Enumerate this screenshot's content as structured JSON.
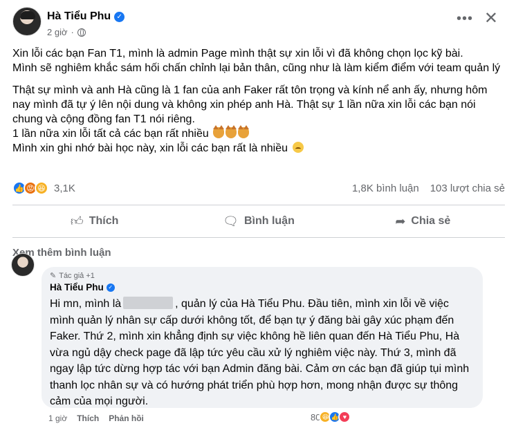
{
  "post": {
    "author": "Hà Tiểu Phu",
    "time": "2 giờ",
    "paragraphs": [
      "Xin lỗi các bạn Fan T1, mình là admin Page mình thật sự xin lỗi vì đã không chọn lọc kỹ bài.",
      "Mình sẽ nghiêm khắc sám hối chấn chỉnh lại bản thân, cũng như là làm kiểm điểm với team quản lý",
      "Thật sự mình và anh Hà cũng là 1 fan của anh Faker rất tôn trọng và kính nể anh ấy, nhưng hôm nay mình đã tự ý lên nội  dung và không xin phép anh Hà. Thật sự 1 lần nữa xin lỗi các bạn nói chung và cộng đồng fan T1 nói riêng.",
      "1 lần nữa xin lỗi tất cả các bạn rất nhiều",
      "Mình xin ghi nhớ bài học này, xin lỗi các bạn rất là nhiều"
    ]
  },
  "stats": {
    "reaction_count": "3,1K",
    "comments": "1,8K bình luận",
    "shares": "103 lượt chia sẻ"
  },
  "actions": {
    "like": "Thích",
    "comment": "Bình luận",
    "share": "Chia sẻ"
  },
  "comments_section": {
    "see_more": "Xem thêm bình luận",
    "comment": {
      "author_tag": "Tác giả +1",
      "author": "Hà Tiểu Phu",
      "text_before": "Hi mn, mình là",
      "text_after": ", quản lý của Hà Tiểu Phu. Đầu tiên, mình xin lỗi về việc mình quản lý nhân sự cấp dưới không tốt, để bạn tự ý đăng bài gây xúc phạm đến Faker. Thứ 2, mình xin khẳng định sự việc không hề liên quan đến Hà Tiểu Phu, Hà vừa ngủ dậy check page đã lập tức yêu cầu xử lý nghiêm việc này. Thứ 3, mình đã ngay lập tức dừng hợp tác với bạn Admin đăng bài. Cảm ơn các bạn đã giúp tụi mình thanh lọc nhân sự và có hướng phát triển phù hợp hơn, mong nhận được sự thông cảm của mọi người.",
      "time": "1 giờ",
      "like": "Thích",
      "reply": "Phản hồi",
      "reaction_count": "80"
    }
  },
  "colors": {
    "accent": "#1877f2",
    "secondary_text": "#65676b",
    "bubble": "#f0f2f5"
  }
}
